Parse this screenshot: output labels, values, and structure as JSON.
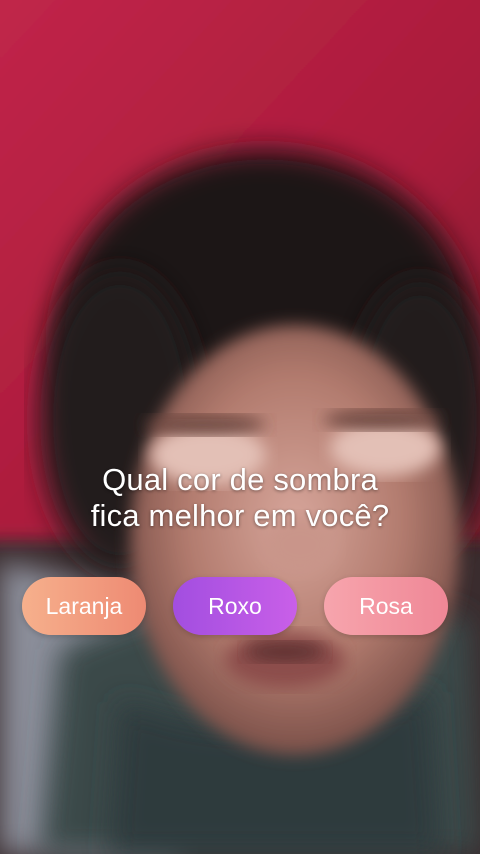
{
  "quiz": {
    "question_line1": "Qual cor de sombra",
    "question_line2": "fica melhor em você?",
    "options": [
      {
        "label": "Laranja",
        "color": "#f2a07f"
      },
      {
        "label": "Roxo",
        "color": "#b656e6"
      },
      {
        "label": "Rosa",
        "color": "#f396a1"
      }
    ]
  },
  "background": {
    "pillow_color": "#b31f3f",
    "hoodie_color": "#3b4a4a"
  }
}
